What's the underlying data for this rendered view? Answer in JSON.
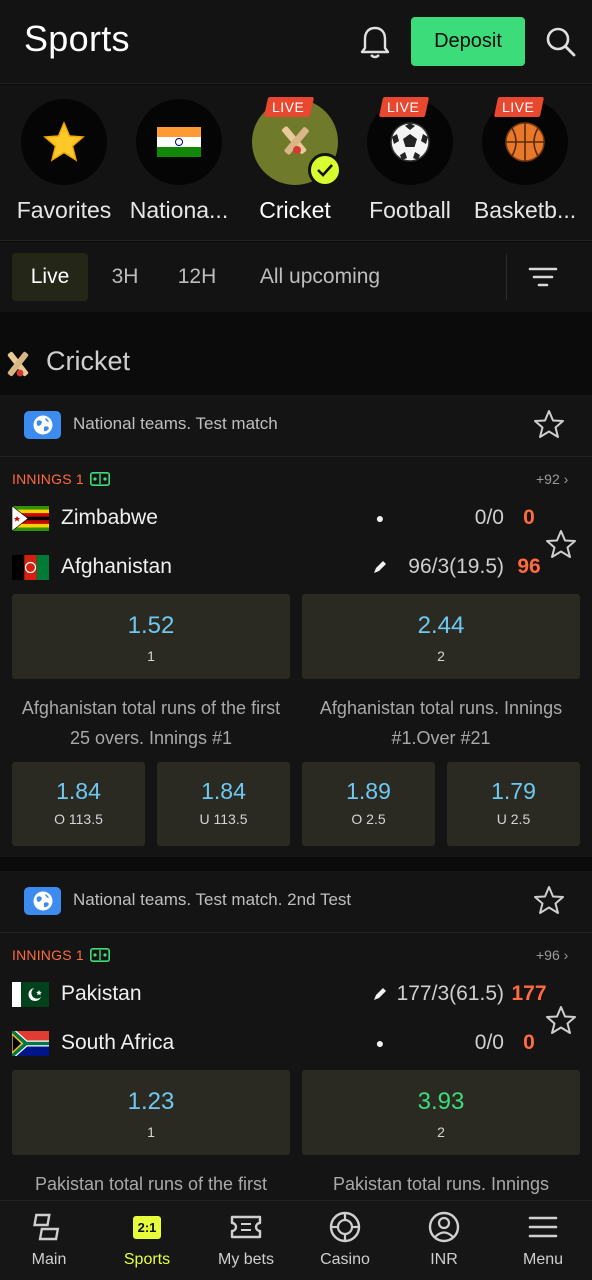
{
  "header": {
    "title": "Sports",
    "deposit_label": "Deposit"
  },
  "categories": [
    {
      "label": "Favorites",
      "live": ""
    },
    {
      "label": "Nationa...",
      "live": ""
    },
    {
      "label": "Cricket",
      "live": "LIVE"
    },
    {
      "label": "Football",
      "live": "LIVE"
    },
    {
      "label": "Basketb...",
      "live": "LIVE"
    }
  ],
  "filters": [
    "Live",
    "3H",
    "12H",
    "All upcoming"
  ],
  "section": {
    "title": "Cricket"
  },
  "matches": [
    {
      "league": "National teams. Test match",
      "innings": "INNINGS 1",
      "more": "+92",
      "teams": [
        {
          "name": "Zimbabwe",
          "score": "0/0",
          "runs": "0"
        },
        {
          "name": "Afghanistan",
          "score": "96/3(19.5)",
          "runs": "96"
        }
      ],
      "main_odds": [
        {
          "value": "1.52",
          "label": "1"
        },
        {
          "value": "2.44",
          "label": "2"
        }
      ],
      "markets": [
        "Afghanistan total runs of the first 25 overs. Innings #1",
        "Afghanistan total runs. Innings #1.Over #21"
      ],
      "small_odds": [
        {
          "value": "1.84",
          "label": "O 113.5"
        },
        {
          "value": "1.84",
          "label": "U 113.5"
        },
        {
          "value": "1.89",
          "label": "O 2.5"
        },
        {
          "value": "1.79",
          "label": "U 2.5"
        }
      ]
    },
    {
      "league": "National teams. Test match. 2nd Test",
      "innings": "INNINGS 1",
      "more": "+96",
      "teams": [
        {
          "name": "Pakistan",
          "score": "177/3(61.5)",
          "runs": "177"
        },
        {
          "name": "South Africa",
          "score": "0/0",
          "runs": "0"
        }
      ],
      "main_odds": [
        {
          "value": "1.23",
          "label": "1"
        },
        {
          "value": "3.93",
          "label": "2"
        }
      ],
      "markets": [
        "Pakistan total runs of the first",
        "Pakistan total runs. Innings"
      ]
    }
  ],
  "nav": [
    {
      "label": "Main"
    },
    {
      "label": "Sports",
      "badge": "2:1"
    },
    {
      "label": "My bets"
    },
    {
      "label": "Casino"
    },
    {
      "label": "INR"
    },
    {
      "label": "Menu"
    }
  ],
  "colors": {
    "accent_green": "#3ddc7b",
    "live_red": "#e8482f",
    "odds_blue": "#6ec9f2",
    "nav_active": "#e6ff3a",
    "innings_orange": "#ff6b3d"
  }
}
